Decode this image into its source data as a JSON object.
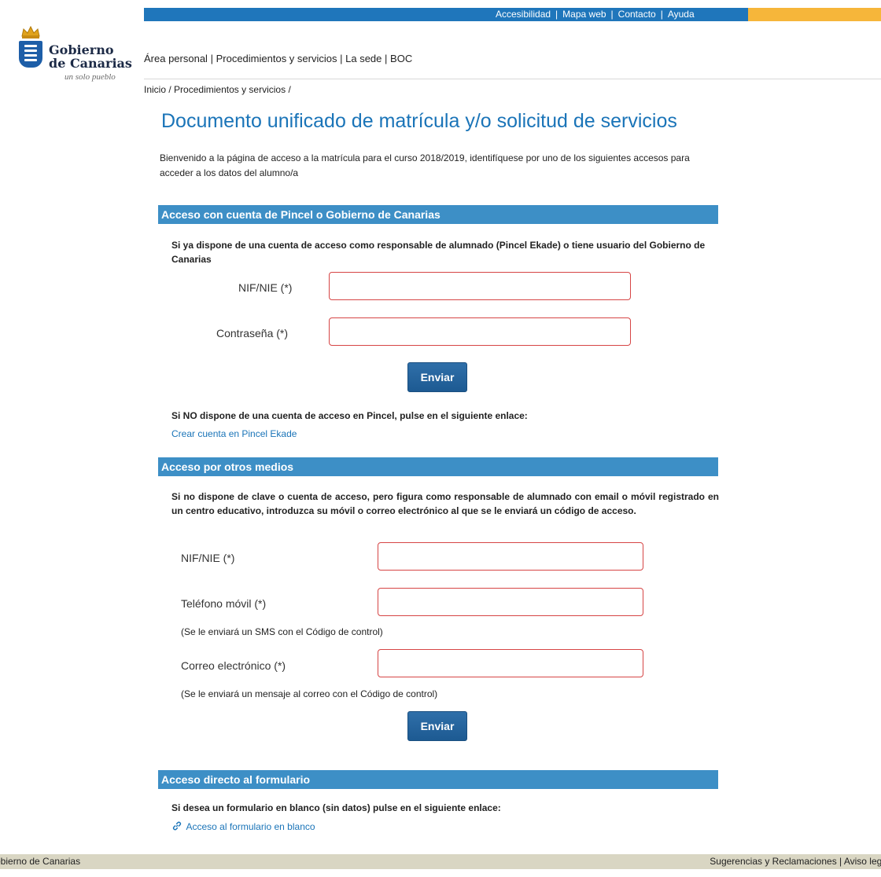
{
  "topbar": {
    "links": [
      "Accesibilidad",
      "Mapa web",
      "Contacto",
      "Ayuda"
    ],
    "separator": "|",
    "colors": {
      "blue": "#1f76bb",
      "orange": "#f6b63a"
    }
  },
  "logo": {
    "line1": "Gobierno",
    "line2": "de Canarias",
    "tagline": "un solo pueblo"
  },
  "nav": {
    "items": [
      "Área personal",
      "Procedimientos y servicios",
      "La sede",
      "BOC"
    ],
    "separator": "|"
  },
  "breadcrumb": {
    "items": [
      "Inicio",
      "Procedimientos y servicios"
    ],
    "separator": "/"
  },
  "page": {
    "title": "Documento unificado de matrícula y/o solicitud de servicios",
    "intro": "Bienvenido a la página de acceso a la matrícula para el curso 2018/2019, identifíquese por uno de los siguientes accesos para acceder a los datos del alumno/a"
  },
  "section1": {
    "header": "Acceso con cuenta de Pincel o Gobierno de Canarias",
    "description": "Si ya dispone de una cuenta de acceso como responsable de alumnado (Pincel Ekade) o tiene usuario del Gobierno de Canarias",
    "nif_label": "NIF/NIE (*)",
    "nif_value": "",
    "password_label": "Contraseña (*)",
    "password_value": "",
    "submit_label": "Enviar",
    "no_account_text": "Si NO dispone de una cuenta de acceso en Pincel, pulse en el siguiente enlace:",
    "create_account_link": "Crear cuenta en Pincel Ekade"
  },
  "section2": {
    "header": "Acceso por otros medios",
    "description": "Si no dispone de clave o cuenta de acceso, pero figura como responsable de alumnado con email o móvil registrado en un centro educativo, introduzca su móvil o correo electrónico al que se le enviará un código de acceso.",
    "nif_label": "NIF/NIE (*)",
    "nif_value": "",
    "phone_label": "Teléfono móvil (*)",
    "phone_value": "",
    "phone_note": "(Se le enviará un SMS con el Código de control)",
    "email_label": "Correo electrónico (*)",
    "email_value": "",
    "email_note": "(Se le enviará un mensaje al correo con el Código de control)",
    "submit_label": "Enviar"
  },
  "section3": {
    "header": "Acceso directo al formulario",
    "description": "Si desea un formulario en blanco (sin datos) pulse en el siguiente enlace:",
    "link_label": "Acceso al formulario en blanco",
    "link_icon": "link-icon"
  },
  "footer": {
    "left": "obierno de Canarias",
    "right_links": [
      "Sugerencias y Reclamaciones",
      "Aviso lega"
    ],
    "separator": "|",
    "color": "#d9d6c3"
  }
}
